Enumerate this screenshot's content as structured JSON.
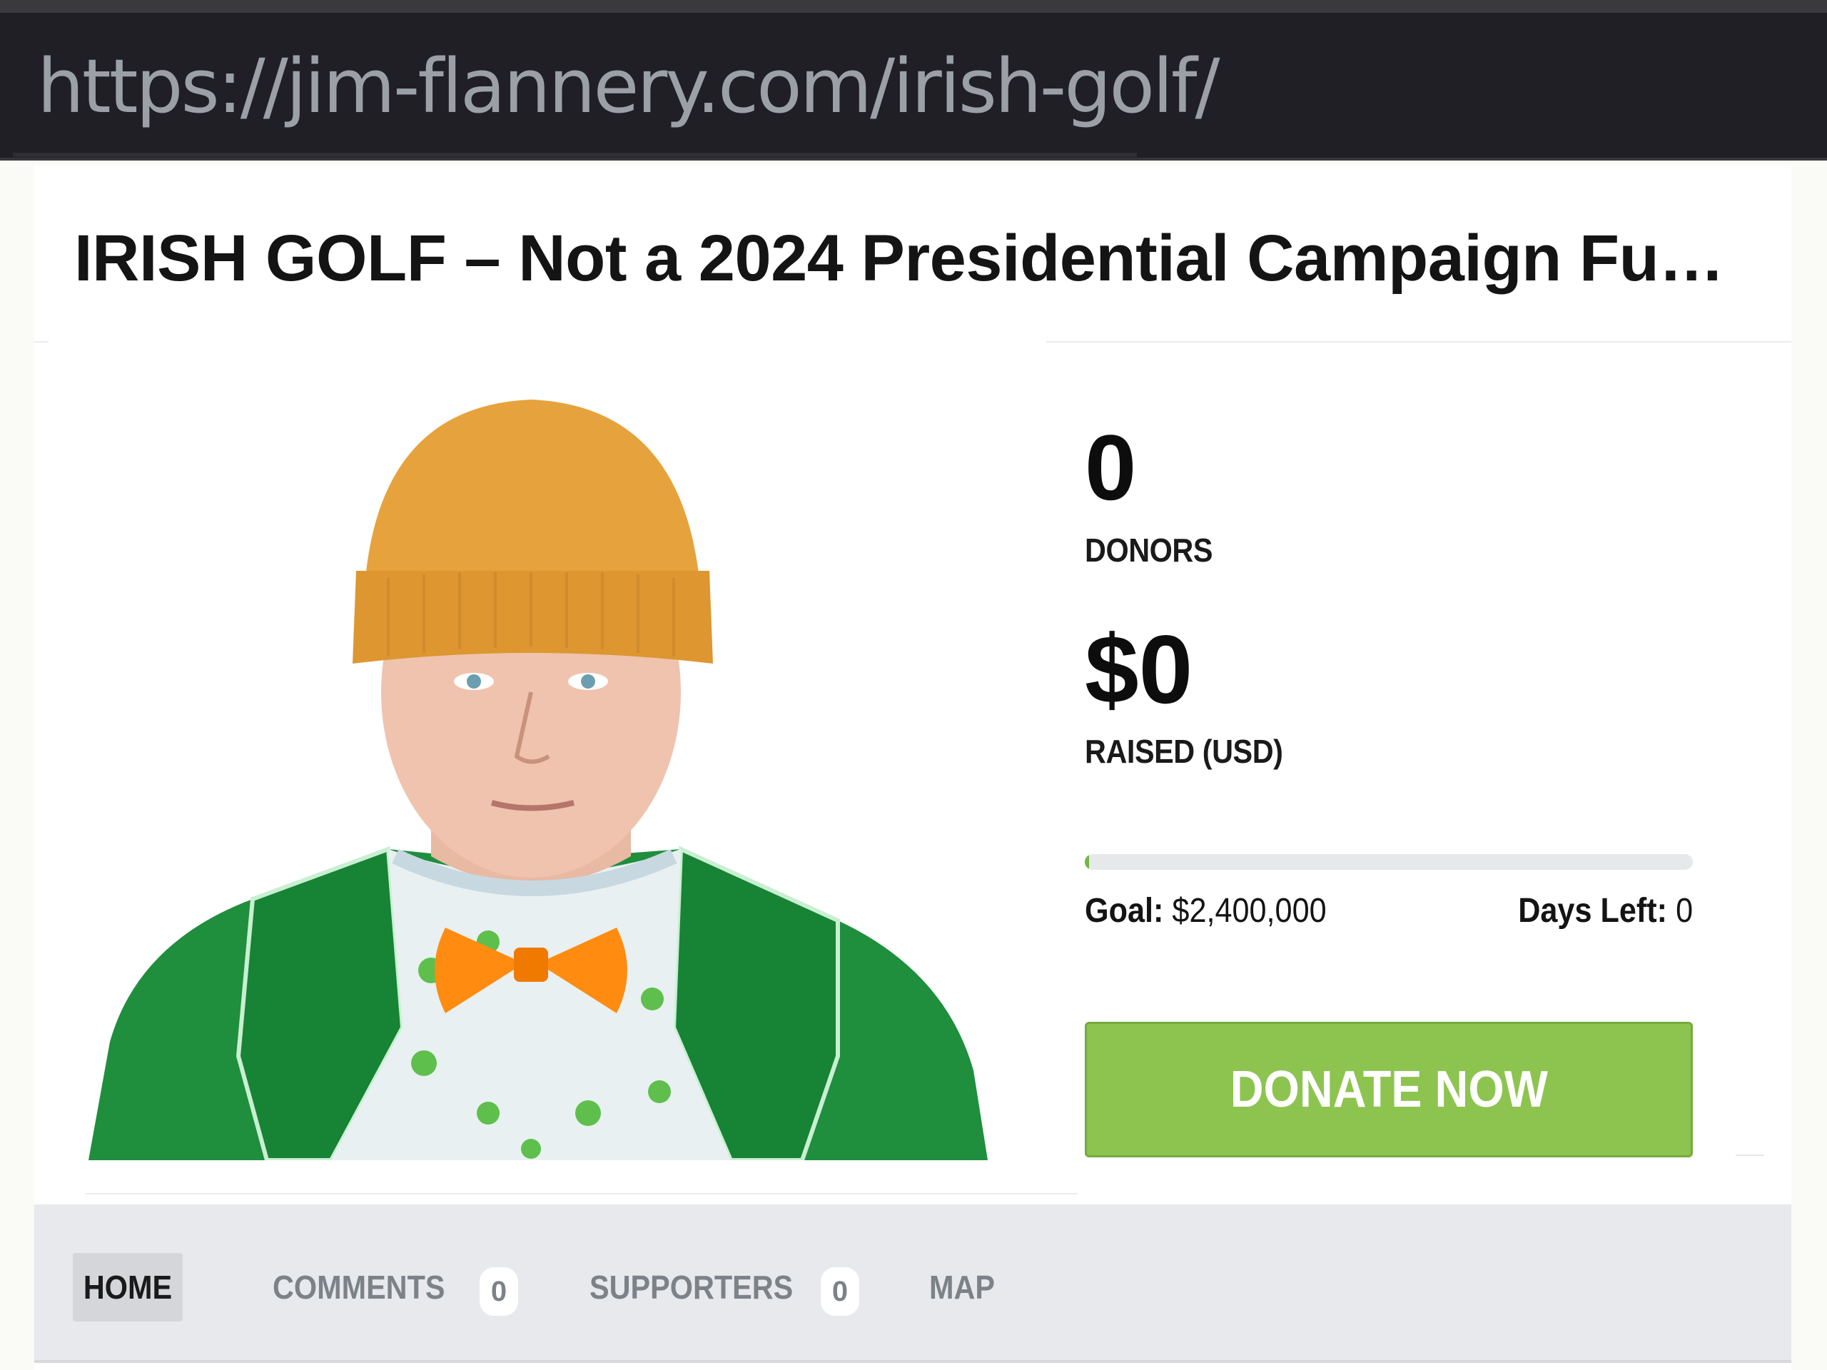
{
  "browser": {
    "url": "https://jim-flannery.com/irish-golf/"
  },
  "campaign": {
    "title": "IRISH GOLF – Not a 2024 Presidential Campaign Fu…",
    "donors_count": "0",
    "donors_label": "DONORS",
    "raised_amount": "$0",
    "raised_label": "RAISED (USD)",
    "progress_fraction": 0,
    "goal_label": "Goal:",
    "goal_value": "$2,400,000",
    "days_left_label": "Days Left:",
    "days_left_value": "0",
    "donate_button": "DONATE NOW"
  },
  "tabs": [
    {
      "label": "HOME",
      "active": true
    },
    {
      "label": "COMMENTS",
      "count": "0"
    },
    {
      "label": "SUPPORTERS",
      "count": "0"
    },
    {
      "label": "MAP"
    }
  ],
  "colors": {
    "accent_green": "#8dc44f",
    "progress_green": "#6fb83f",
    "url_bar_bg": "#1f1f25",
    "hat": "#e9a23a",
    "jacket": "#1e8f3c",
    "bow_tie": "#ff8a00"
  }
}
